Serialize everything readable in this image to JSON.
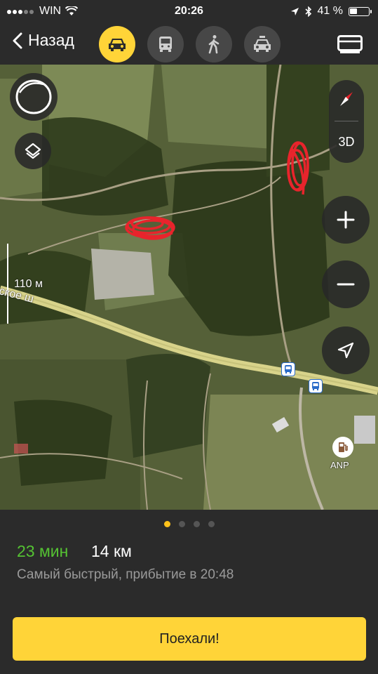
{
  "status": {
    "carrier": "WIN",
    "time": "20:26",
    "battery_text": "41 %",
    "battery_level": 0.41
  },
  "nav": {
    "back_label": "Назад",
    "modes": [
      {
        "icon": "car-icon",
        "active": true
      },
      {
        "icon": "bus-icon",
        "active": false
      },
      {
        "icon": "walk-icon",
        "active": false
      },
      {
        "icon": "taxi-icon",
        "active": false
      }
    ],
    "menu_icon": "list-icon"
  },
  "map": {
    "scale_label": "110 м",
    "road_label": "ское ш",
    "view_3d_label": "3D",
    "fuel_label": "ANP"
  },
  "route": {
    "duration": "23 мин",
    "distance": "14 км",
    "description": "Самый быстрый, прибытие в 20:48",
    "active_page": 0,
    "page_count": 4
  },
  "action": {
    "go_label": "Поехали!"
  },
  "colors": {
    "accent_yellow": "#ffd438",
    "duration_green": "#55c233",
    "panel_bg": "#2b2b2b",
    "scribble_red": "#e8242c"
  }
}
